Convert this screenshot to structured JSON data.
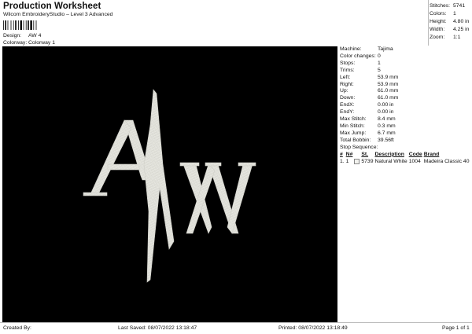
{
  "header": {
    "title": "Production Worksheet",
    "subtitle": "Wilcom EmbroideryStudio – Level 3 Advanced",
    "design_label": "Design:",
    "design_value": "AW 4",
    "colorway_label": "Colorway:",
    "colorway_value": "Colorway 1"
  },
  "summary": {
    "stitches_label": "Stitches:",
    "stitches": "5741",
    "colors_label": "Colors:",
    "colors": "1",
    "height_label": "Height:",
    "height": "4.80 in",
    "width_label": "Width:",
    "width": "4.25 in",
    "zoom_label": "Zoom:",
    "zoom": "1:1"
  },
  "details": {
    "machine_label": "Machine:",
    "machine": "Tajima",
    "color_changes_label": "Color changes:",
    "color_changes": "0",
    "stops_label": "Stops:",
    "stops": "1",
    "trims_label": "Trims:",
    "trims": "5",
    "left_label": "Left:",
    "left": "53.9 mm",
    "right_label": "Right:",
    "right": "53.9 mm",
    "up_label": "Up:",
    "up": "61.0 mm",
    "down_label": "Down:",
    "down": "61.0 mm",
    "endx_label": "EndX:",
    "endx": "0.00 in",
    "endy_label": "EndY:",
    "endy": "0.00 in",
    "max_stitch_label": "Max Stitch:",
    "max_stitch": "8.4 mm",
    "min_stitch_label": "Min Stitch:",
    "min_stitch": "0.3 mm",
    "max_jump_label": "Max Jump:",
    "max_jump": "6.7 mm",
    "total_bobbin_label": "Total Bobbin:",
    "total_bobbin": "39.56ft",
    "stop_sequence_label": "Stop Sequence:"
  },
  "stop_table": {
    "headers": [
      "#",
      "N#",
      "",
      "St.",
      "Description",
      "Code",
      "Brand"
    ],
    "rows": [
      {
        "num": "1.",
        "n": "1",
        "st": "5739",
        "description": "Natural White",
        "code": "1004",
        "brand": "Madeira Classic 40"
      }
    ]
  },
  "design": {
    "lettering": "AW",
    "thread_color": "#e8e8e2",
    "background": "#000000"
  },
  "footer": {
    "created_by": "Created By:",
    "last_saved": "Last Saved: 08/07/2022 13:18:47",
    "printed": "Printed: 08/07/2022 13:18:49",
    "page": "Page 1 of 1"
  }
}
